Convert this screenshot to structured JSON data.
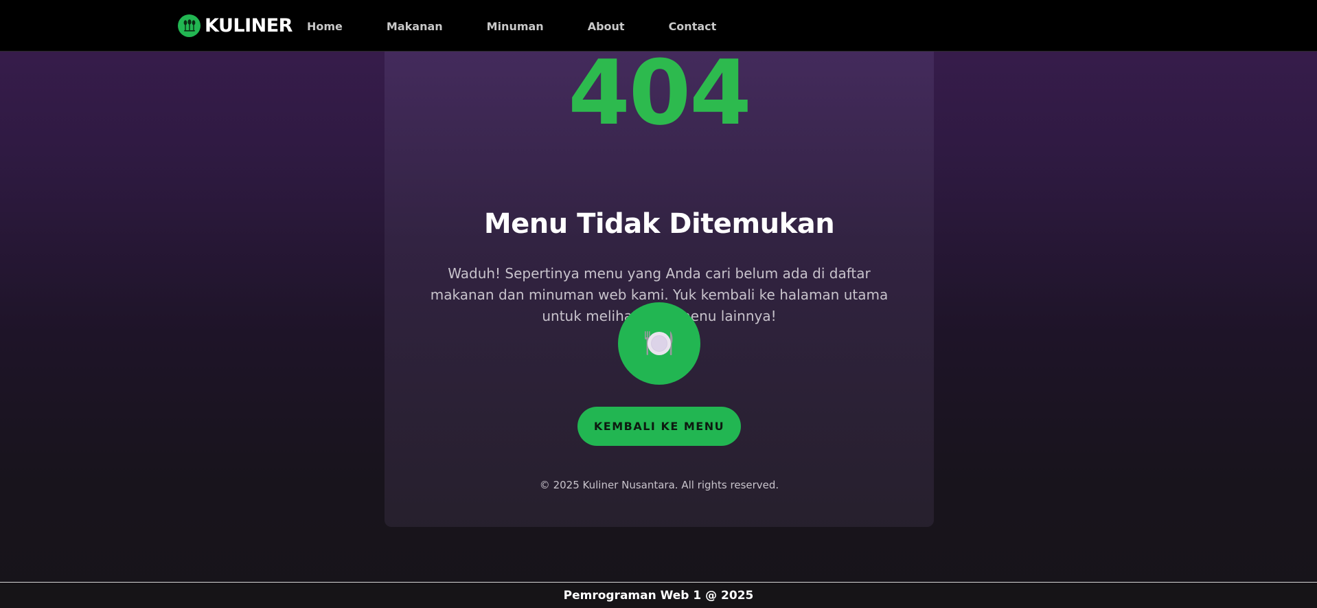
{
  "navbar": {
    "brand": "KULINER",
    "links": [
      "Home",
      "Makanan",
      "Minuman",
      "About",
      "Contact"
    ]
  },
  "main": {
    "code": "404",
    "title": "Menu Tidak Ditemukan",
    "description": "Waduh! Sepertinya menu yang Anda cari belum ada di daftar makanan dan minuman web kami. Yuk kembali ke halaman utama untuk melihat-lihat menu lainnya!",
    "button_label": "KEMBALI KE MENU",
    "copyright": "© 2025 Kuliner Nusantara. All rights reserved."
  },
  "footer": {
    "text": "Pemrograman Web 1 @ 2025"
  },
  "icons": {
    "logo": "kuliner-logo-icon",
    "plate": "plate-cutlery-icon"
  },
  "colors": {
    "accent": "#22b652",
    "navbar_bg": "#000000",
    "heading_404": "#2dba4e"
  }
}
